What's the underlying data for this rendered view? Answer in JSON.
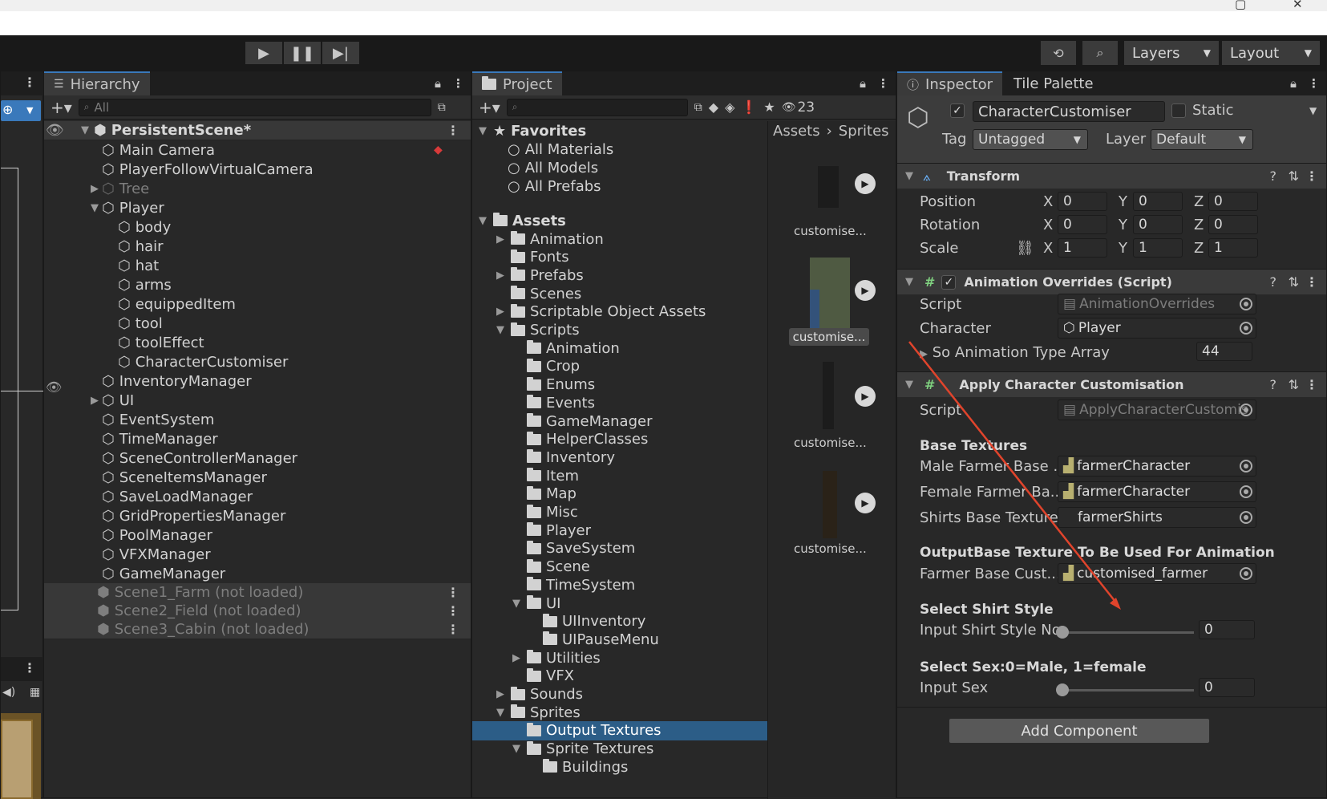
{
  "toolbar": {
    "layers_label": "Layers",
    "layout_label": "Layout"
  },
  "hierarchy": {
    "tab_label": "Hierarchy",
    "search_placeholder": "All",
    "scene": "PersistentScene*",
    "items": [
      "Main Camera",
      "PlayerFollowVirtualCamera",
      "Tree",
      "Player",
      "body",
      "hair",
      "hat",
      "arms",
      "equippedItem",
      "tool",
      "toolEffect",
      "CharacterCustomiser",
      "InventoryManager",
      "UI",
      "EventSystem",
      "TimeManager",
      "SceneControllerManager",
      "SceneItemsManager",
      "SaveLoadManager",
      "GridPropertiesManager",
      "PoolManager",
      "VFXManager",
      "GameManager"
    ],
    "unloaded_scenes": [
      "Scene1_Farm (not loaded)",
      "Scene2_Field (not loaded)",
      "Scene3_Cabin (not loaded)"
    ]
  },
  "project": {
    "tab_label": "Project",
    "hidden_count": "23",
    "favorites_label": "Favorites",
    "favorites": [
      "All Materials",
      "All Models",
      "All Prefabs"
    ],
    "assets_label": "Assets",
    "tree": [
      "Animation",
      "Fonts",
      "Prefabs",
      "Scenes",
      "Scriptable Object Assets",
      "Scripts",
      "Animation",
      "Crop",
      "Enums",
      "Events",
      "GameManager",
      "HelperClasses",
      "Inventory",
      "Item",
      "Map",
      "Misc",
      "Player",
      "SaveSystem",
      "Scene",
      "TimeSystem",
      "UI",
      "UIInventory",
      "UIPauseMenu",
      "Utilities",
      "VFX",
      "Sounds",
      "Sprites",
      "Output Textures",
      "Sprite Textures",
      "Buildings"
    ],
    "breadcrumb": [
      "Assets",
      "Sprites"
    ],
    "thumbs": [
      "customise...",
      "customise...",
      "customise...",
      "customise..."
    ]
  },
  "inspector": {
    "tab_label": "Inspector",
    "tab2_label": "Tile Palette",
    "object_name": "CharacterCustomiser",
    "static_label": "Static",
    "tag_label": "Tag",
    "tag_value": "Untagged",
    "layer_label": "Layer",
    "layer_value": "Default",
    "transform": {
      "title": "Transform",
      "position_label": "Position",
      "rotation_label": "Rotation",
      "scale_label": "Scale",
      "x": "X",
      "y": "Y",
      "z": "Z",
      "position": [
        "0",
        "0",
        "0"
      ],
      "rotation": [
        "0",
        "0",
        "0"
      ],
      "scale": [
        "1",
        "1",
        "1"
      ]
    },
    "anim": {
      "title": "Animation Overrides (Script)",
      "script_label": "Script",
      "script_value": "AnimationOverrides",
      "character_label": "Character",
      "character_value": "Player",
      "array_label": "So Animation Type Array",
      "array_value": "44"
    },
    "apply": {
      "title": "Apply Character Customisation",
      "script_label": "Script",
      "script_value": "ApplyCharacterCustomis",
      "base_textures": "Base Textures",
      "male_label": "Male Farmer Base ...",
      "male_value": "farmerCharacter",
      "female_label": "Female Farmer Ba...",
      "female_value": "farmerCharacter",
      "shirts_label": "Shirts Base Texture",
      "shirts_value": "farmerShirts",
      "output_header": "OutputBase Texture To Be Used For Animation",
      "output_label": "Farmer Base Cust...",
      "output_value": "customised_farmer",
      "shirt_header": "Select Shirt Style",
      "shirt_label": "Input Shirt Style No",
      "shirt_value": "0",
      "sex_header": "Select Sex:0=Male, 1=female",
      "sex_label": "Input Sex",
      "sex_value": "0"
    },
    "add_component": "Add Component"
  },
  "colors": {
    "accent": "#3a79bb",
    "selection": "#2c5d87",
    "arrow": "#e0442c"
  }
}
